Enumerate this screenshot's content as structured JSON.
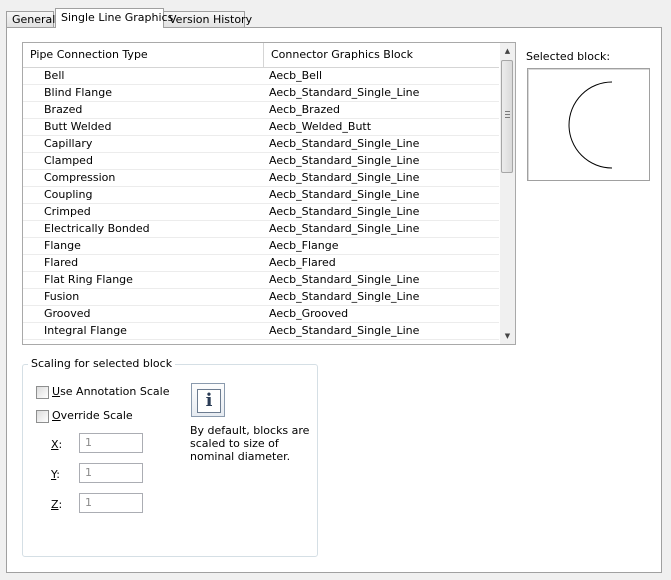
{
  "tabs": [
    "General",
    "Single Line Graphics",
    "Version History"
  ],
  "table": {
    "columns": [
      "Pipe Connection Type",
      "Connector Graphics Block"
    ],
    "rows": [
      [
        "Bell",
        "Aecb_Bell"
      ],
      [
        "Blind Flange",
        "Aecb_Standard_Single_Line"
      ],
      [
        "Brazed",
        "Aecb_Brazed"
      ],
      [
        "Butt Welded",
        "Aecb_Welded_Butt"
      ],
      [
        "Capillary",
        "Aecb_Standard_Single_Line"
      ],
      [
        "Clamped",
        "Aecb_Standard_Single_Line"
      ],
      [
        "Compression",
        "Aecb_Standard_Single_Line"
      ],
      [
        "Coupling",
        "Aecb_Standard_Single_Line"
      ],
      [
        "Crimped",
        "Aecb_Standard_Single_Line"
      ],
      [
        "Electrically Bonded",
        "Aecb_Standard_Single_Line"
      ],
      [
        "Flange",
        "Aecb_Flange"
      ],
      [
        "Flared",
        "Aecb_Flared"
      ],
      [
        "Flat Ring Flange",
        "Aecb_Standard_Single_Line"
      ],
      [
        "Fusion",
        "Aecb_Standard_Single_Line"
      ],
      [
        "Grooved",
        "Aecb_Grooved"
      ],
      [
        "Integral Flange",
        "Aecb_Standard_Single_Line"
      ]
    ]
  },
  "selected_block_label": "Selected block:",
  "scaling": {
    "title": "Scaling for selected block",
    "use_annotation_scale": {
      "label_key": "U",
      "label_rest": "se Annotation Scale"
    },
    "override_scale": {
      "label_key": "O",
      "label_rest": "verride Scale"
    },
    "x": {
      "key": "X",
      "rest": ":",
      "value": "1"
    },
    "y": {
      "key": "Y",
      "rest": ":",
      "value": "1"
    },
    "z": {
      "key": "Z",
      "rest": ":",
      "value": "1"
    },
    "info_text": "By default, blocks are scaled to size of nominal diameter."
  },
  "icons": {
    "info": "info-icon",
    "scroll_up": "scroll-up-arrow-icon",
    "scroll_down": "scroll-down-arrow-icon"
  }
}
